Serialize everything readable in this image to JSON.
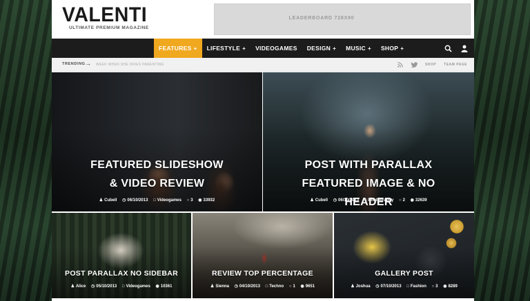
{
  "header": {
    "logo_title": "VALENTI",
    "logo_tagline": "ULTIMATE PREMIUM MAGAZINE",
    "ad_label": "LEADERBOARD 728X90"
  },
  "nav": {
    "items": [
      {
        "label": "FEATURES",
        "has_sub": true,
        "active": true
      },
      {
        "label": "LIFESTYLE",
        "has_sub": true
      },
      {
        "label": "VIDEOGAMES",
        "has_sub": false
      },
      {
        "label": "DESIGN",
        "has_sub": true
      },
      {
        "label": "MUSIC",
        "has_sub": true
      },
      {
        "label": "SHOP",
        "has_sub": true
      }
    ],
    "plus": "+",
    "accent_color": "#f0a81f"
  },
  "trending": {
    "label": "TRENDING",
    "arrow": "→",
    "text": "WEEK WHEN SHE DRIES PARENTING",
    "shop": "SHOP",
    "team": "TEAM PAGE"
  },
  "posts": [
    {
      "title": "FEATURED SLIDESHOW & VIDEO REVIEW",
      "author": "Cubell",
      "date": "06/10/2013",
      "category": "Videogames",
      "comments": "3",
      "views": "33932"
    },
    {
      "title": "POST WITH PARALLAX FEATURED IMAGE & NO HEADER",
      "author": "Cubell",
      "date": "06/10/2013",
      "category": "Photography",
      "comments": "2",
      "views": "32639"
    },
    {
      "title": "POST PARALLAX NO SIDEBAR",
      "author": "Alice",
      "date": "05/10/2013",
      "category": "Videogames",
      "comments": "",
      "views": "10361"
    },
    {
      "title": "REVIEW TOP PERCENTAGE",
      "author": "Sienna",
      "date": "04/10/2013",
      "category": "Techno",
      "comments": "1",
      "views": "9651"
    },
    {
      "title": "GALLERY POST",
      "author": "Joshua",
      "date": "07/10/2013",
      "category": "Fashion",
      "comments": "3",
      "views": "8289"
    }
  ]
}
